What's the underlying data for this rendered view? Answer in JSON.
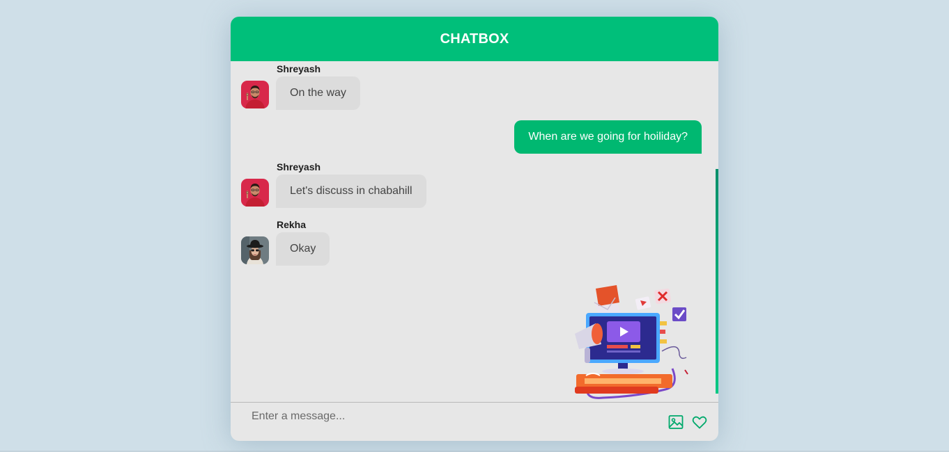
{
  "header": {
    "title": "CHATBOX"
  },
  "messages": [
    {
      "sender": "Shreyash",
      "text": "On the way",
      "direction": "incoming",
      "avatar": "man-red-shirt"
    },
    {
      "text": "When are we going for hoiliday?",
      "direction": "outgoing"
    },
    {
      "sender": "Shreyash",
      "text": "Let's discuss in chabahill",
      "direction": "incoming",
      "avatar": "man-red-shirt"
    },
    {
      "sender": "Rekha",
      "text": "Okay",
      "direction": "incoming",
      "avatar": "woman-hat"
    }
  ],
  "composer": {
    "placeholder": "Enter a message...",
    "value": "",
    "icons": [
      "image-icon",
      "heart-icon"
    ]
  },
  "colors": {
    "accent": "#00bf7a",
    "outgoing_bubble": "#00b871",
    "incoming_bubble": "#dcdcdc",
    "panel_bg": "#e7e7e7",
    "page_bg": "#cfdfe8"
  }
}
